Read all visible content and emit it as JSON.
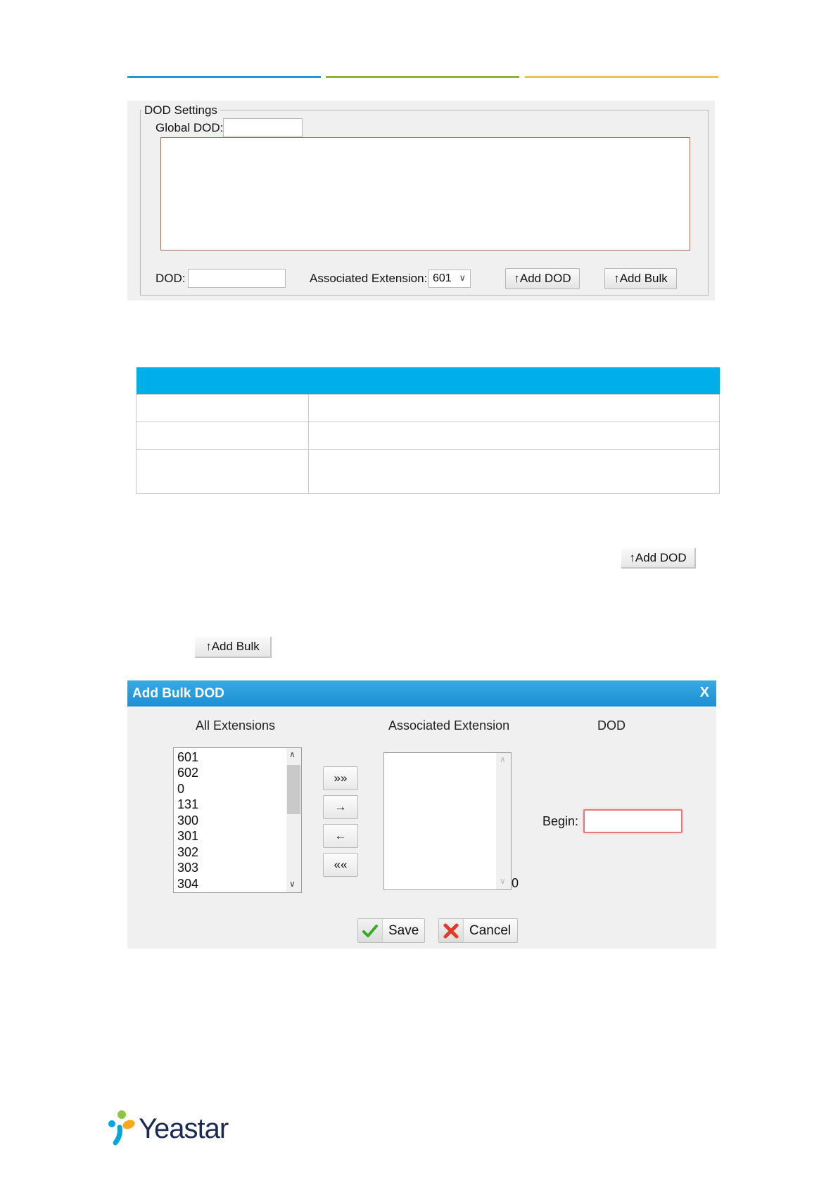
{
  "header_line_colors": [
    "#1e9ad6",
    "#8cb437",
    "#eac351"
  ],
  "dod_settings": {
    "legend": "DOD Settings",
    "global_dod_label": "Global DOD:",
    "global_dod_value": "",
    "dod_label": "DOD:",
    "dod_value": "",
    "assoc_ext_label": "Associated Extension:",
    "assoc_ext_value": "601",
    "add_dod_label": "↑Add DOD",
    "add_bulk_label": "↑Add Bulk"
  },
  "table": {
    "header_color": "#00aee8",
    "rows": [
      [
        "",
        ""
      ],
      [
        "",
        ""
      ],
      [
        "",
        ""
      ]
    ]
  },
  "inline_buttons": {
    "add_dod_label": "↑Add DOD",
    "add_bulk_label": "↑Add Bulk"
  },
  "bulk_dialog": {
    "title": "Add Bulk DOD",
    "close_label": "X",
    "all_extensions_heading": "All Extensions",
    "associated_extension_heading": "Associated Extension",
    "dod_heading": "DOD",
    "all_extensions": [
      "601",
      "602",
      "0",
      "131",
      "300",
      "301",
      "302",
      "303",
      "304"
    ],
    "associated_count": "0",
    "move_all_right": "»»",
    "move_right": "→",
    "move_left": "←",
    "move_all_left": "««",
    "begin_label": "Begin:",
    "begin_value": "",
    "save_label": "Save",
    "cancel_label": "Cancel"
  },
  "logo": {
    "text": "Yeastar"
  }
}
